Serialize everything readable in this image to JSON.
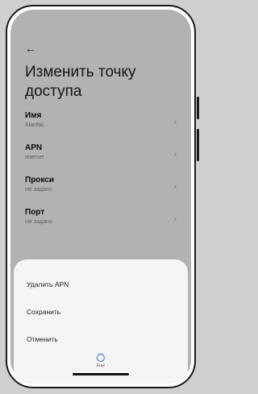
{
  "header": {
    "back_icon": "arrow-left-icon",
    "title": "Изменить точку доступа"
  },
  "fields": [
    {
      "label": "Имя",
      "value": "Alanfail"
    },
    {
      "label": "APN",
      "value": "internet"
    },
    {
      "label": "Прокси",
      "value": "Не задано"
    },
    {
      "label": "Порт",
      "value": "Не задано"
    }
  ],
  "sheet": {
    "items": [
      "Удалить APN",
      "Сохранить",
      "Отменить"
    ],
    "more_label": "Ещё",
    "more_icon": "more-dots-icon"
  },
  "colors": {
    "accent": "#2a6bd4",
    "scrim": "rgba(0,0,0,0.30)",
    "sheet_bg": "#f5f5f5"
  }
}
